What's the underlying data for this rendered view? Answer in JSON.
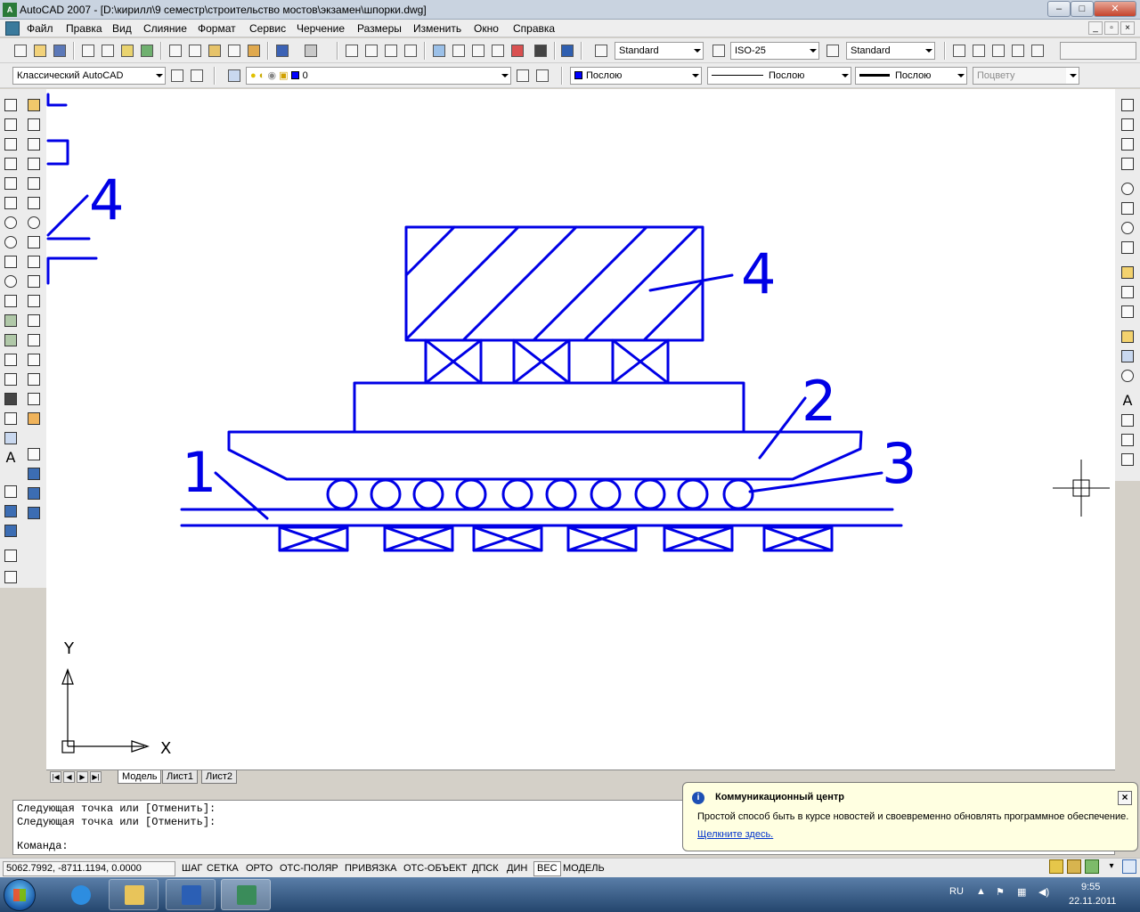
{
  "window": {
    "title": "AutoCAD 2007 - [D:\\кирилл\\9 семестр\\строительство мостов\\экзамен\\шпорки.dwg]",
    "app_badge": "A"
  },
  "menu": {
    "items": [
      "Файл",
      "Правка",
      "Вид",
      "Слияние",
      "Формат",
      "Сервис",
      "Черчение",
      "Размеры",
      "Изменить",
      "Окно",
      "Справка"
    ]
  },
  "toolbar": {
    "text_style": "Standard",
    "dim_style": "ISO-25",
    "table_style": "Standard",
    "workspace": "Классический AutoCAD",
    "layer": "0",
    "color": "Послою",
    "linetype": "Послою",
    "lineweight": "Послою",
    "plotstyle": "Поцвету"
  },
  "drawing": {
    "labels": {
      "label_1": "1",
      "label_2": "2",
      "label_3": "3",
      "label_4": "4",
      "label_4_partial": "4"
    },
    "ucs": {
      "y_label": "Y",
      "x_label": "X"
    },
    "stroke_color": "#0000e6"
  },
  "layout_tabs": [
    "Модель",
    "Лист1",
    "Лист2"
  ],
  "command": {
    "history": [
      "Следующая точка или [Отменить]:",
      "Следующая точка или [Отменить]:"
    ],
    "prompt": "Команда:"
  },
  "status": {
    "coordinates": "5062.7992, -8711.1194, 0.0000",
    "buttons": [
      "ШАГ",
      "СЕТКА",
      "ОРТО",
      "ОТС-ПОЛЯР",
      "ПРИВЯЗКА",
      "ОТС-ОБЪЕКТ",
      "ДПСК",
      "ДИН",
      "ВЕС",
      "МОДЕЛЬ"
    ],
    "active_buttons": [
      "ВЕС"
    ]
  },
  "notification": {
    "title": "Коммуникационный центр",
    "body": "Простой способ быть в курсе новостей и своевременно обновлять программное обеспечение.",
    "link": "Щелкните здесь."
  },
  "taskbar": {
    "apps": [
      "file-explorer",
      "word",
      "autocad"
    ],
    "language": "RU",
    "time": "9:55",
    "date": "22.11.2011"
  }
}
